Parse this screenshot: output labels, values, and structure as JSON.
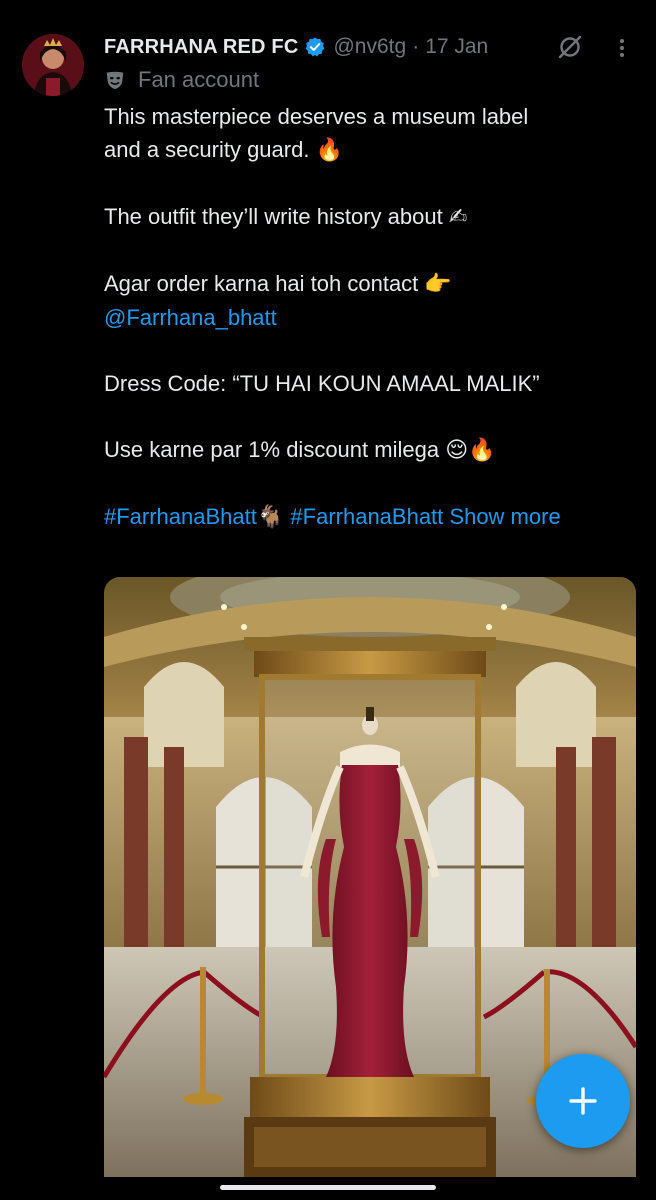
{
  "tweet": {
    "author": {
      "display_name": "FARRHANA RED FC",
      "handle": "@nv6tg",
      "verified": true,
      "avatar_icon": "avatar-photo"
    },
    "separator": "·",
    "date": "17 Jan",
    "label": {
      "icon": "theater-mask-icon",
      "text": "Fan account"
    },
    "body": {
      "line1": "This masterpiece deserves a museum label",
      "line2": "and a security guard.",
      "line2_emoji": "🔥",
      "line3": "The outfit they’ll write history about",
      "line3_emoji": "✍",
      "line4": "Agar order karna hai toh contact",
      "line4_emoji": "👉",
      "mention": "@Farrhana_bhatt",
      "line5": "Dress Code: “TU HAI KOUN AMAAL MALIK”",
      "line6": "Use karne par 1% discount milega",
      "line6_emoji": "😌🔥",
      "hashtag1": "#FarrhanaBhatt",
      "hashtag1_emoji": "🐐",
      "hashtag2": "#FarrhanaBhatt",
      "show_more": "Show more"
    },
    "media": {
      "description_icon": "museum-dress-photo"
    }
  },
  "colors": {
    "background": "#000000",
    "text_primary": "#e7e9ea",
    "text_secondary": "#71767b",
    "accent": "#1d9bf0"
  },
  "fab": {
    "icon": "plus-icon"
  }
}
